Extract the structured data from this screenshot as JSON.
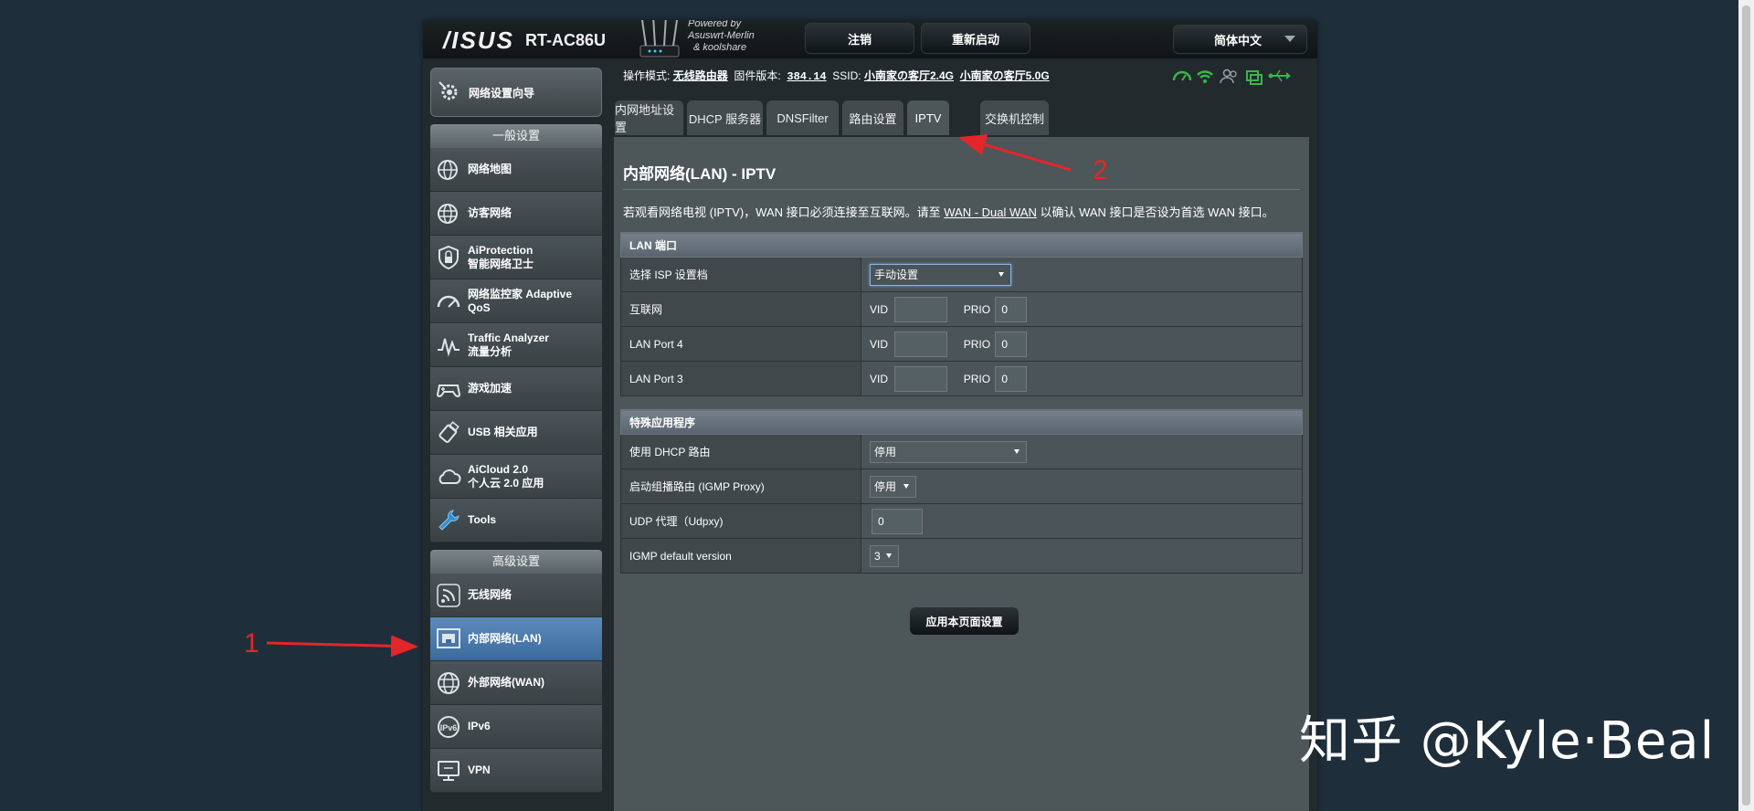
{
  "header": {
    "logo": "/ISUS",
    "model": "RT-AC86U",
    "merlin_text": [
      "Powered by",
      "Asuswrt-Merlin",
      "& koolshare"
    ],
    "logout": "注销",
    "reboot": "重新启动",
    "language": "简体中文"
  },
  "sidebar": {
    "qis": "网络设置向导",
    "general_title": "一般设置",
    "general_items": [
      {
        "label": "网络地图",
        "icon": "globe-network-icon"
      },
      {
        "label": "访客网络",
        "icon": "guest-globe-icon"
      },
      {
        "label": "AiProtection\n智能网络卫士",
        "icon": "shield-lock-icon"
      },
      {
        "label": "网络监控家 Adaptive\nQoS",
        "icon": "speedometer-icon"
      },
      {
        "label": "Traffic Analyzer\n流量分析",
        "icon": "traffic-graph-icon"
      },
      {
        "label": "游戏加速",
        "icon": "gamepad-icon"
      },
      {
        "label": "USB 相关应用",
        "icon": "usb-stick-icon"
      },
      {
        "label": "AiCloud 2.0\n个人云 2.0 应用",
        "icon": "cloud-icon"
      },
      {
        "label": "Tools",
        "icon": "wrench-icon"
      }
    ],
    "advanced_title": "高级设置",
    "advanced_items": [
      {
        "label": "无线网络",
        "icon": "wireless-icon"
      },
      {
        "label": "内部网络(LAN)",
        "icon": "lan-port-icon"
      },
      {
        "label": "外部网络(WAN)",
        "icon": "wan-globe-icon"
      },
      {
        "label": "IPv6",
        "icon": "ipv6-icon"
      },
      {
        "label": "VPN",
        "icon": "vpn-monitor-icon"
      }
    ]
  },
  "status": {
    "mode_label": "操作模式:",
    "mode_value": "无线路由器",
    "fw_label": "固件版本:",
    "fw_value": "384.14",
    "ssid_label": "SSID:",
    "ssid_24": "小南家の客厅2.4G",
    "ssid_5": "小南家の客厅5.0G",
    "icons": [
      "internet-status-icon",
      "wifi-status-icon",
      "users-icon",
      "sync-icon",
      "usb-status-icon"
    ]
  },
  "tabs": [
    "内网地址设置",
    "DHCP 服务器",
    "DNSFilter",
    "路由设置",
    "IPTV",
    "交换机控制"
  ],
  "active_tab": "IPTV",
  "page": {
    "title": "内部网络(LAN) - IPTV",
    "desc_before": "若观看网络电视 (IPTV)，WAN 接口必须连接至互联网。请至 ",
    "desc_link": "WAN - Dual WAN",
    "desc_after": " 以确认 WAN 接口是否设为首选 WAN 接口。",
    "lan_section": "LAN 端口",
    "isp_label": "选择 ISP 设置档",
    "isp_value": "手动设置",
    "vid_label": "VID",
    "prio_label": "PRIO",
    "ports": [
      {
        "name": "互联网",
        "vid": "",
        "prio": "0"
      },
      {
        "name": "LAN Port 4",
        "vid": "",
        "prio": "0"
      },
      {
        "name": "LAN Port 3",
        "vid": "",
        "prio": "0"
      }
    ],
    "special_section": "特殊应用程序",
    "special_rows": [
      {
        "label": "使用 DHCP 路由",
        "value": "停用"
      },
      {
        "label": "启动组播路由 (IGMP Proxy)",
        "value": "停用"
      },
      {
        "label": "UDP 代理（Udpxy)",
        "value": "0"
      },
      {
        "label": "IGMP default version",
        "value": "3"
      }
    ],
    "apply_label": "应用本页面设置"
  },
  "annotations": {
    "num1": "1",
    "num2": "2",
    "arrow_color": "#e3262a"
  },
  "watermark": "知乎 @Kyle·Beal"
}
